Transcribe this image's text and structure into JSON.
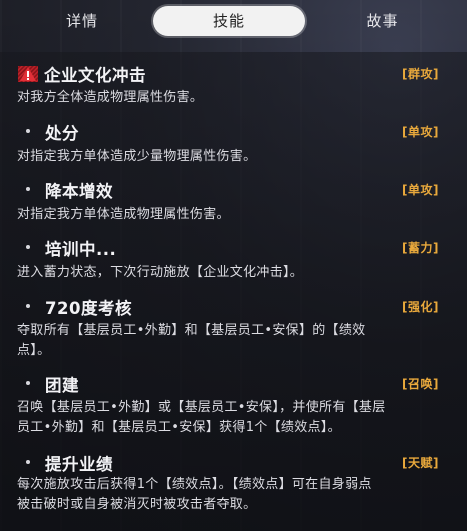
{
  "tabs": [
    "详情",
    "技能",
    "故事"
  ],
  "active_tab": "技能",
  "colors": {
    "tag": "#e9a93c",
    "warning": "#d6262e",
    "active_tab_bg": "#f2f2f2"
  },
  "skills": [
    {
      "name": "企业文化冲击",
      "tag": "[群攻]",
      "icon": "warning-icon",
      "desc_lines": [
        "对我方全体造成物理属性伤害。"
      ]
    },
    {
      "name": "处分",
      "tag": "[单攻]",
      "desc_lines": [
        "对指定我方单体造成少量物理属性伤害。"
      ]
    },
    {
      "name": "降本增效",
      "tag": "[单攻]",
      "desc_lines": [
        "对指定我方单体造成物理属性伤害。"
      ]
    },
    {
      "name": "培训中...",
      "tag": "[蓄力]",
      "desc_lines": [
        "进入蓄力状态，下次行动施放【企业文化冲击】。"
      ]
    },
    {
      "name": "720度考核",
      "tag": "[强化]",
      "desc_lines": [
        "夺取所有【基层员工•外勤】和【基层员工•安保】的【绩效",
        "点】。"
      ]
    },
    {
      "name": "团建",
      "tag": "[召唤]",
      "desc_lines": [
        "召唤【基层员工•外勤】或【基层员工•安保】，并使所有【基层",
        "员工•外勤】和【基层员工•安保】获得1个【绩效点】。"
      ]
    },
    {
      "name": "提升业绩",
      "tag": "[天赋]",
      "desc_lines": [
        "每次施放攻击后获得1个【绩效点】。【绩效点】可在自身弱点",
        "被击破时或自身被消灭时被攻击者夺取。"
      ]
    }
  ]
}
